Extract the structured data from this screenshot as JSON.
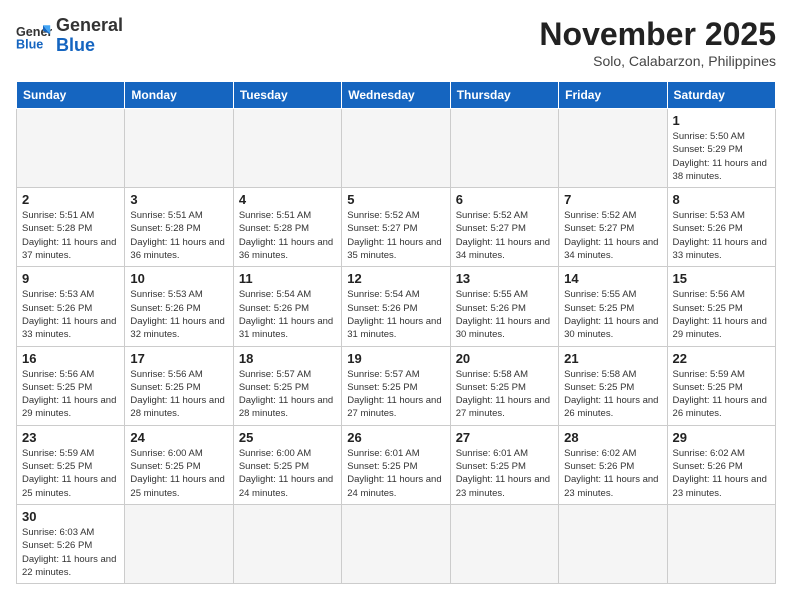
{
  "header": {
    "logo_general": "General",
    "logo_blue": "Blue",
    "month_title": "November 2025",
    "location": "Solo, Calabarzon, Philippines"
  },
  "weekdays": [
    "Sunday",
    "Monday",
    "Tuesday",
    "Wednesday",
    "Thursday",
    "Friday",
    "Saturday"
  ],
  "weeks": [
    [
      {
        "day": "",
        "sunrise": "",
        "sunset": "",
        "daylight": ""
      },
      {
        "day": "",
        "sunrise": "",
        "sunset": "",
        "daylight": ""
      },
      {
        "day": "",
        "sunrise": "",
        "sunset": "",
        "daylight": ""
      },
      {
        "day": "",
        "sunrise": "",
        "sunset": "",
        "daylight": ""
      },
      {
        "day": "",
        "sunrise": "",
        "sunset": "",
        "daylight": ""
      },
      {
        "day": "",
        "sunrise": "",
        "sunset": "",
        "daylight": ""
      },
      {
        "day": "1",
        "sunrise": "Sunrise: 5:50 AM",
        "sunset": "Sunset: 5:29 PM",
        "daylight": "Daylight: 11 hours and 38 minutes."
      }
    ],
    [
      {
        "day": "2",
        "sunrise": "Sunrise: 5:51 AM",
        "sunset": "Sunset: 5:28 PM",
        "daylight": "Daylight: 11 hours and 37 minutes."
      },
      {
        "day": "3",
        "sunrise": "Sunrise: 5:51 AM",
        "sunset": "Sunset: 5:28 PM",
        "daylight": "Daylight: 11 hours and 36 minutes."
      },
      {
        "day": "4",
        "sunrise": "Sunrise: 5:51 AM",
        "sunset": "Sunset: 5:28 PM",
        "daylight": "Daylight: 11 hours and 36 minutes."
      },
      {
        "day": "5",
        "sunrise": "Sunrise: 5:52 AM",
        "sunset": "Sunset: 5:27 PM",
        "daylight": "Daylight: 11 hours and 35 minutes."
      },
      {
        "day": "6",
        "sunrise": "Sunrise: 5:52 AM",
        "sunset": "Sunset: 5:27 PM",
        "daylight": "Daylight: 11 hours and 34 minutes."
      },
      {
        "day": "7",
        "sunrise": "Sunrise: 5:52 AM",
        "sunset": "Sunset: 5:27 PM",
        "daylight": "Daylight: 11 hours and 34 minutes."
      },
      {
        "day": "8",
        "sunrise": "Sunrise: 5:53 AM",
        "sunset": "Sunset: 5:26 PM",
        "daylight": "Daylight: 11 hours and 33 minutes."
      }
    ],
    [
      {
        "day": "9",
        "sunrise": "Sunrise: 5:53 AM",
        "sunset": "Sunset: 5:26 PM",
        "daylight": "Daylight: 11 hours and 33 minutes."
      },
      {
        "day": "10",
        "sunrise": "Sunrise: 5:53 AM",
        "sunset": "Sunset: 5:26 PM",
        "daylight": "Daylight: 11 hours and 32 minutes."
      },
      {
        "day": "11",
        "sunrise": "Sunrise: 5:54 AM",
        "sunset": "Sunset: 5:26 PM",
        "daylight": "Daylight: 11 hours and 31 minutes."
      },
      {
        "day": "12",
        "sunrise": "Sunrise: 5:54 AM",
        "sunset": "Sunset: 5:26 PM",
        "daylight": "Daylight: 11 hours and 31 minutes."
      },
      {
        "day": "13",
        "sunrise": "Sunrise: 5:55 AM",
        "sunset": "Sunset: 5:26 PM",
        "daylight": "Daylight: 11 hours and 30 minutes."
      },
      {
        "day": "14",
        "sunrise": "Sunrise: 5:55 AM",
        "sunset": "Sunset: 5:25 PM",
        "daylight": "Daylight: 11 hours and 30 minutes."
      },
      {
        "day": "15",
        "sunrise": "Sunrise: 5:56 AM",
        "sunset": "Sunset: 5:25 PM",
        "daylight": "Daylight: 11 hours and 29 minutes."
      }
    ],
    [
      {
        "day": "16",
        "sunrise": "Sunrise: 5:56 AM",
        "sunset": "Sunset: 5:25 PM",
        "daylight": "Daylight: 11 hours and 29 minutes."
      },
      {
        "day": "17",
        "sunrise": "Sunrise: 5:56 AM",
        "sunset": "Sunset: 5:25 PM",
        "daylight": "Daylight: 11 hours and 28 minutes."
      },
      {
        "day": "18",
        "sunrise": "Sunrise: 5:57 AM",
        "sunset": "Sunset: 5:25 PM",
        "daylight": "Daylight: 11 hours and 28 minutes."
      },
      {
        "day": "19",
        "sunrise": "Sunrise: 5:57 AM",
        "sunset": "Sunset: 5:25 PM",
        "daylight": "Daylight: 11 hours and 27 minutes."
      },
      {
        "day": "20",
        "sunrise": "Sunrise: 5:58 AM",
        "sunset": "Sunset: 5:25 PM",
        "daylight": "Daylight: 11 hours and 27 minutes."
      },
      {
        "day": "21",
        "sunrise": "Sunrise: 5:58 AM",
        "sunset": "Sunset: 5:25 PM",
        "daylight": "Daylight: 11 hours and 26 minutes."
      },
      {
        "day": "22",
        "sunrise": "Sunrise: 5:59 AM",
        "sunset": "Sunset: 5:25 PM",
        "daylight": "Daylight: 11 hours and 26 minutes."
      }
    ],
    [
      {
        "day": "23",
        "sunrise": "Sunrise: 5:59 AM",
        "sunset": "Sunset: 5:25 PM",
        "daylight": "Daylight: 11 hours and 25 minutes."
      },
      {
        "day": "24",
        "sunrise": "Sunrise: 6:00 AM",
        "sunset": "Sunset: 5:25 PM",
        "daylight": "Daylight: 11 hours and 25 minutes."
      },
      {
        "day": "25",
        "sunrise": "Sunrise: 6:00 AM",
        "sunset": "Sunset: 5:25 PM",
        "daylight": "Daylight: 11 hours and 24 minutes."
      },
      {
        "day": "26",
        "sunrise": "Sunrise: 6:01 AM",
        "sunset": "Sunset: 5:25 PM",
        "daylight": "Daylight: 11 hours and 24 minutes."
      },
      {
        "day": "27",
        "sunrise": "Sunrise: 6:01 AM",
        "sunset": "Sunset: 5:25 PM",
        "daylight": "Daylight: 11 hours and 23 minutes."
      },
      {
        "day": "28",
        "sunrise": "Sunrise: 6:02 AM",
        "sunset": "Sunset: 5:26 PM",
        "daylight": "Daylight: 11 hours and 23 minutes."
      },
      {
        "day": "29",
        "sunrise": "Sunrise: 6:02 AM",
        "sunset": "Sunset: 5:26 PM",
        "daylight": "Daylight: 11 hours and 23 minutes."
      }
    ],
    [
      {
        "day": "30",
        "sunrise": "Sunrise: 6:03 AM",
        "sunset": "Sunset: 5:26 PM",
        "daylight": "Daylight: 11 hours and 22 minutes."
      },
      {
        "day": "",
        "sunrise": "",
        "sunset": "",
        "daylight": ""
      },
      {
        "day": "",
        "sunrise": "",
        "sunset": "",
        "daylight": ""
      },
      {
        "day": "",
        "sunrise": "",
        "sunset": "",
        "daylight": ""
      },
      {
        "day": "",
        "sunrise": "",
        "sunset": "",
        "daylight": ""
      },
      {
        "day": "",
        "sunrise": "",
        "sunset": "",
        "daylight": ""
      },
      {
        "day": "",
        "sunrise": "",
        "sunset": "",
        "daylight": ""
      }
    ]
  ]
}
